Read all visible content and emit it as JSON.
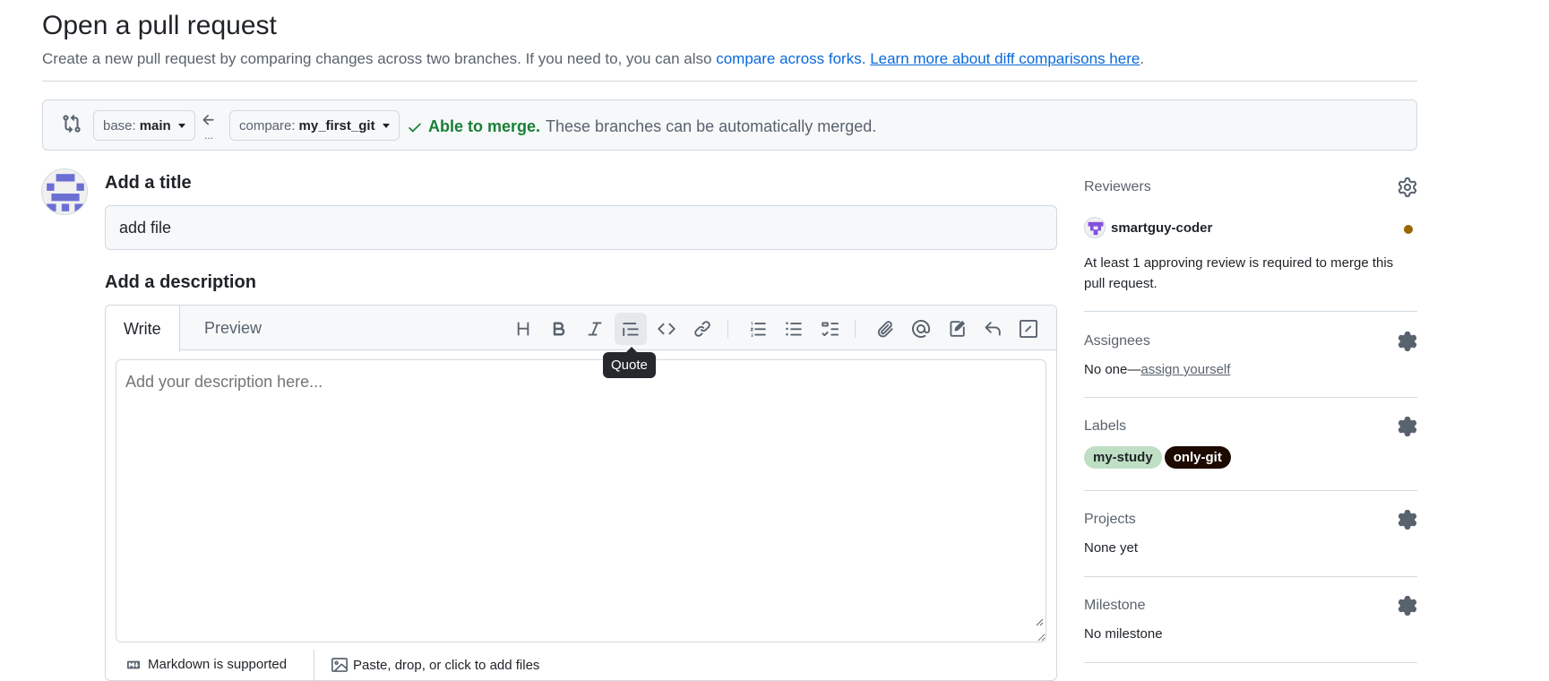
{
  "header": {
    "title": "Open a pull request",
    "subtitle_prefix": "Create a new pull request by comparing changes across two branches. If you need to, you can also ",
    "compare_forks_link": "compare across forks.",
    "learn_more_link": "Learn more about diff comparisons here",
    "subtitle_suffix": "."
  },
  "range": {
    "base_prefix": "base:",
    "base_branch": "main",
    "compare_prefix": "compare:",
    "compare_branch": "my_first_git",
    "dots": "...",
    "merge_ok": "Able to merge.",
    "merge_msg": "These branches can be automatically merged."
  },
  "form": {
    "title_label": "Add a title",
    "title_value": "add file",
    "description_label": "Add a description",
    "description_placeholder": "Add your description here...",
    "tab_write": "Write",
    "tab_preview": "Preview",
    "tooltip": "Quote",
    "markdown_note": "Markdown is supported",
    "attach_note": "Paste, drop, or click to add files"
  },
  "sidebar": {
    "reviewers": {
      "heading": "Reviewers",
      "user": "smartguy-coder",
      "note": "At least 1 approving review is required to merge this pull request."
    },
    "assignees": {
      "heading": "Assignees",
      "none": "No one—",
      "assign_link": "assign yourself"
    },
    "labels": {
      "heading": "Labels",
      "items": [
        {
          "name": "my-study",
          "bg": "#bfdfc4",
          "fg": "#1f2328"
        },
        {
          "name": "only-git",
          "bg": "#1c0a00",
          "fg": "#ffffff"
        }
      ]
    },
    "projects": {
      "heading": "Projects",
      "value": "None yet"
    },
    "milestone": {
      "heading": "Milestone",
      "value": "No milestone"
    }
  },
  "colors": {
    "accent_link": "#0969da",
    "success": "#1a7f37",
    "pending": "#9a6700",
    "identicon": "#6b6fd4"
  }
}
